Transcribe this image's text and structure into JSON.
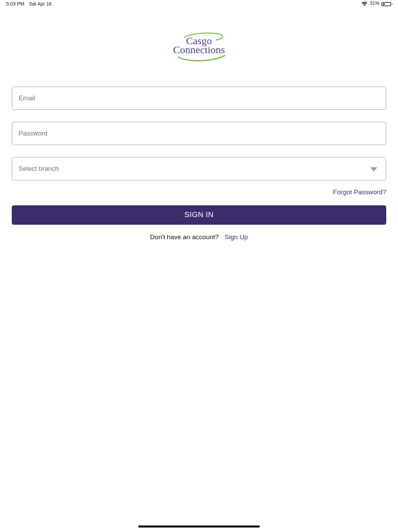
{
  "status_bar": {
    "time": "5:03 PM",
    "date": "Sat Apr 18",
    "battery_percent_label": "31%",
    "battery_level": 0.31
  },
  "logo": {
    "line1": "Casgo",
    "line2": "Connections",
    "brand_color": "#4a3a7a",
    "swoosh_color": "#6db33f"
  },
  "form": {
    "email_placeholder": "Email",
    "password_placeholder": "Password",
    "branch_placeholder": "Select branch",
    "forgot_password": "Forgot Password?",
    "sign_in": "SIGN IN",
    "no_account_text": "Don't have an account?",
    "sign_up": "Sign Up"
  },
  "colors": {
    "primary": "#3b2d6c",
    "link": "#3b2f6b",
    "border": "#c8c8c8"
  }
}
